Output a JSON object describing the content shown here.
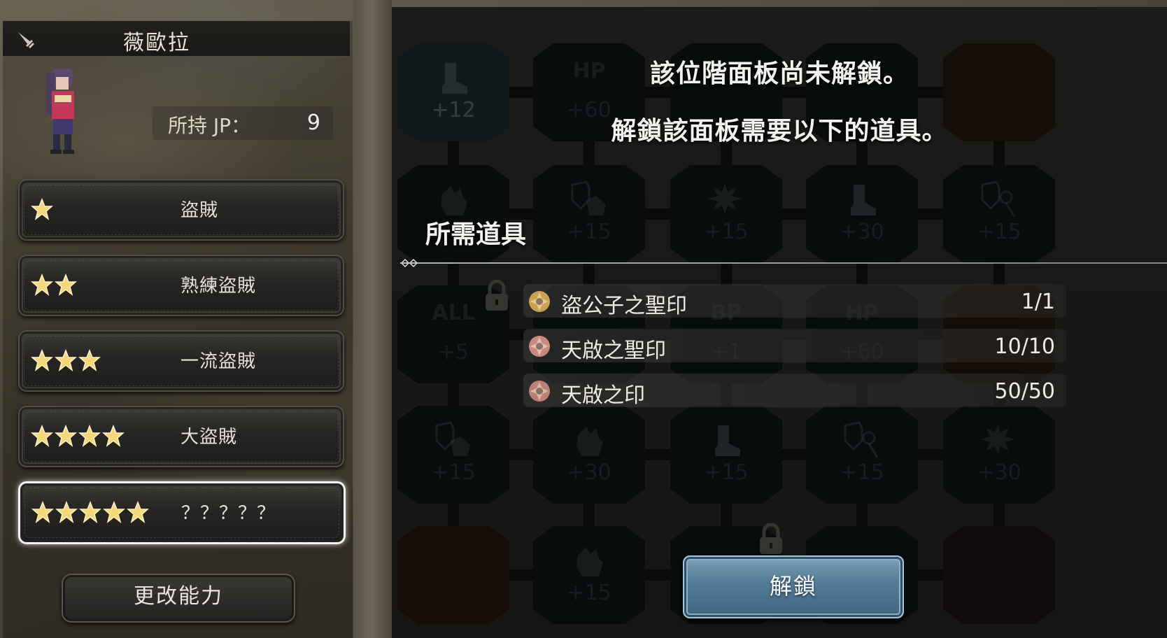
{
  "character": {
    "name": "薇歐拉",
    "jp_label": "所持 JP：",
    "jp_value": "9"
  },
  "jobs": [
    {
      "stars": 1,
      "label": "盜賊",
      "selected": false
    },
    {
      "stars": 2,
      "label": "熟練盜賊",
      "selected": false
    },
    {
      "stars": 3,
      "label": "一流盜賊",
      "selected": false
    },
    {
      "stars": 4,
      "label": "大盜賊",
      "selected": false
    },
    {
      "stars": 5,
      "label": "？？？？？",
      "selected": true
    }
  ],
  "change_ability_label": "更改能力",
  "board": {
    "rows": [
      [
        {
          "top": "",
          "value": "+12",
          "icon": "boot-icon",
          "style": "hl"
        },
        {
          "top": "HP",
          "value": "+60",
          "icon": "",
          "style": ""
        },
        {
          "top": "",
          "value": "",
          "icon": "",
          "style": ""
        },
        {
          "top": "",
          "value": "",
          "icon": "",
          "style": ""
        },
        {
          "top": "",
          "value": "",
          "icon": "",
          "style": "orange"
        }
      ],
      [
        {
          "top": "",
          "value": "",
          "icon": "fist-icon",
          "style": ""
        },
        {
          "top": "",
          "value": "+15",
          "icon": "shield-fist-icon",
          "style": ""
        },
        {
          "top": "",
          "value": "+15",
          "icon": "burst-icon",
          "style": ""
        },
        {
          "top": "",
          "value": "+30",
          "icon": "boot-icon",
          "style": ""
        },
        {
          "top": "",
          "value": "+15",
          "icon": "shield-magic-icon",
          "style": ""
        }
      ],
      [
        {
          "top": "ALL",
          "value": "+5",
          "icon": "",
          "style": ""
        },
        {
          "top": "",
          "value": "",
          "icon": "",
          "style": ""
        },
        {
          "top": "BP",
          "value": "+1",
          "icon": "",
          "style": ""
        },
        {
          "top": "HP",
          "value": "+60",
          "icon": "",
          "style": ""
        },
        {
          "top": "",
          "value": "",
          "icon": "",
          "style": "orange"
        }
      ],
      [
        {
          "top": "",
          "value": "+15",
          "icon": "shield-fist-icon",
          "style": ""
        },
        {
          "top": "",
          "value": "+30",
          "icon": "fist-icon",
          "style": ""
        },
        {
          "top": "",
          "value": "+15",
          "icon": "boot-icon",
          "style": ""
        },
        {
          "top": "",
          "value": "+15",
          "icon": "shield-magic-icon",
          "style": ""
        },
        {
          "top": "",
          "value": "+30",
          "icon": "burst-icon",
          "style": ""
        }
      ],
      [
        {
          "top": "",
          "value": "",
          "icon": "",
          "style": "orange"
        },
        {
          "top": "",
          "value": "+15",
          "icon": "fist-icon",
          "style": ""
        },
        {
          "top": "",
          "value": "",
          "icon": "",
          "style": ""
        },
        {
          "top": "",
          "value": "",
          "icon": "",
          "style": ""
        },
        {
          "top": "",
          "value": "",
          "icon": "",
          "style": "purple"
        }
      ]
    ]
  },
  "dialog": {
    "line1": "該位階面板尚未解鎖。",
    "line2": "解鎖該面板需要以下的道具。",
    "required_title": "所需道具",
    "items": [
      {
        "name": "盜公子之聖印",
        "count": "1/1",
        "icon": "gold-seal-icon",
        "color": "#c9a24e"
      },
      {
        "name": "天啟之聖印",
        "count": "10/10",
        "icon": "pink-seal-icon",
        "color": "#c98a7e"
      },
      {
        "name": "天啟之印",
        "count": "50/50",
        "icon": "pink-seal-icon",
        "color": "#b98274"
      }
    ],
    "unlock_label": "解鎖"
  }
}
